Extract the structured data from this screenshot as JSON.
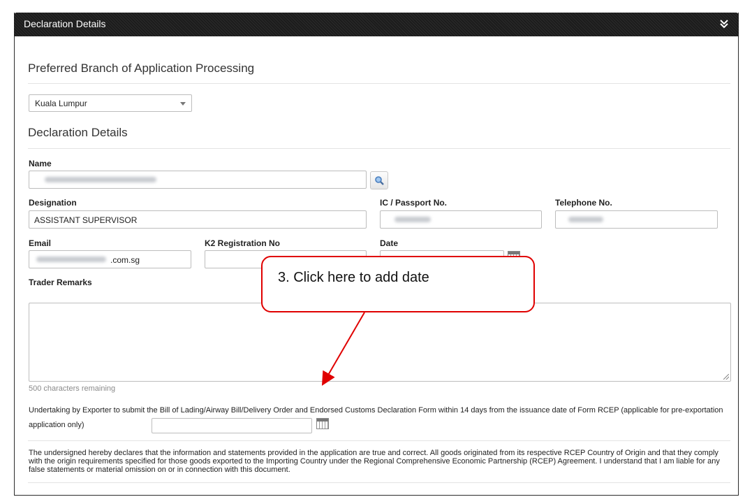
{
  "panel": {
    "title": "Declaration Details"
  },
  "branch": {
    "heading": "Preferred Branch of Application Processing",
    "selected": "Kuala Lumpur"
  },
  "declaration": {
    "heading": "Declaration Details",
    "name_label": "Name",
    "designation_label": "Designation",
    "designation_value": "ASSISTANT SUPERVISOR",
    "ic_label": "IC / Passport No.",
    "telephone_label": "Telephone No.",
    "email_label": "Email",
    "email_suffix": ".com.sg",
    "k2_label": "K2 Registration No",
    "date_label": "Date",
    "remarks_label": "Trader Remarks",
    "remaining": "500 characters remaining",
    "undertaking": "Undertaking by Exporter to submit the Bill of Lading/Airway Bill/Delivery Order and Endorsed Customs Declaration Form within 14 days from the issuance date of Form RCEP (applicable for pre-exportation application only)",
    "statement": "The undersigned hereby declares that the information and statements provided in the application are true and correct. All goods originated from its respective RCEP Country of Origin and that they comply with the origin requirements specified for those goods exported to the Importing Country under the Regional Comprehensive Economic Partnership (RCEP) Agreement. I understand that I am liable for any false statements or material omission on or in connection with this document."
  },
  "callout": {
    "text": "3. Click here to add date"
  },
  "colors": {
    "header": "#1c1c1c",
    "callout_border": "#e00000",
    "help_icon": "#d04a1d"
  }
}
